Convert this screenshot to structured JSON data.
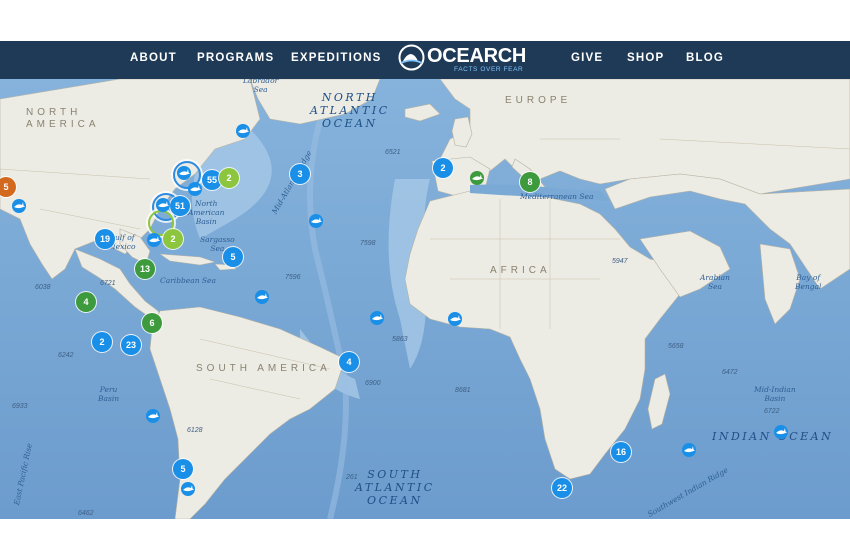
{
  "nav": {
    "left": [
      "ABOUT",
      "PROGRAMS",
      "EXPEDITIONS"
    ],
    "right": [
      "GIVE",
      "SHOP",
      "BLOG"
    ],
    "logo_text": "OCEARCH",
    "logo_tagline": "FACTS OVER FEAR"
  },
  "colors": {
    "nav_bg": "#1f3a56",
    "ocean": "#7aa9d6",
    "land": "#ecebe4",
    "cluster_blue": "#1a8fe8",
    "cluster_green": "#3d9a3d",
    "cluster_lime": "#8cc63f",
    "cluster_orange": "#d2691e"
  },
  "map": {
    "ocean_labels": {
      "north_atlantic": "NORTH\nATLANTIC\nOCEAN",
      "south_atlantic": "SOUTH\nATLANTIC\nOCEAN",
      "indian": "INDIAN OCEAN"
    },
    "land_labels": {
      "north_america": "NORTH\nAMERICA",
      "europe": "EUROPE",
      "africa": "AFRICA",
      "south_america": "SOUTH AMERICA"
    },
    "feature_labels": {
      "labrador_sea": "Labrador\nSea",
      "na_basin": "North\nAmerican\nBasin",
      "sargasso": "Sargasso\nSea",
      "gulf_mexico": "Gulf of\nMexico",
      "caribbean": "Caribbean Sea",
      "mid_atlantic": "Mid-Atlantic Ridge",
      "med_sea": "Mediterranean Sea",
      "arabian": "Arabian\nSea",
      "bengal": "Bay of\nBengal",
      "peru_basin": "Peru\nBasin",
      "east_pacific": "East Pacific Rise",
      "mid_indian": "Mid-Indian\nBasin",
      "sw_indian": "Southwest Indian Ridge"
    },
    "depths": [
      "6521",
      "7598",
      "7596",
      "5947",
      "6038",
      "6721",
      "6242",
      "6933",
      "6128",
      "5658",
      "6472",
      "6722",
      "5863",
      "6900",
      "8681",
      "261",
      "6462"
    ],
    "clusters": [
      "5",
      "55",
      "2",
      "51",
      "3",
      "2",
      "8",
      "19",
      "2",
      "5",
      "13",
      "4",
      "6",
      "2",
      "23",
      "4",
      "16",
      "5",
      "22"
    ],
    "sharks": [
      "shark",
      "shark",
      "shark",
      "shark",
      "shark",
      "shark",
      "shark",
      "shark",
      "shark",
      "shark",
      "shark",
      "shark",
      "shark",
      "shark",
      "shark"
    ]
  }
}
